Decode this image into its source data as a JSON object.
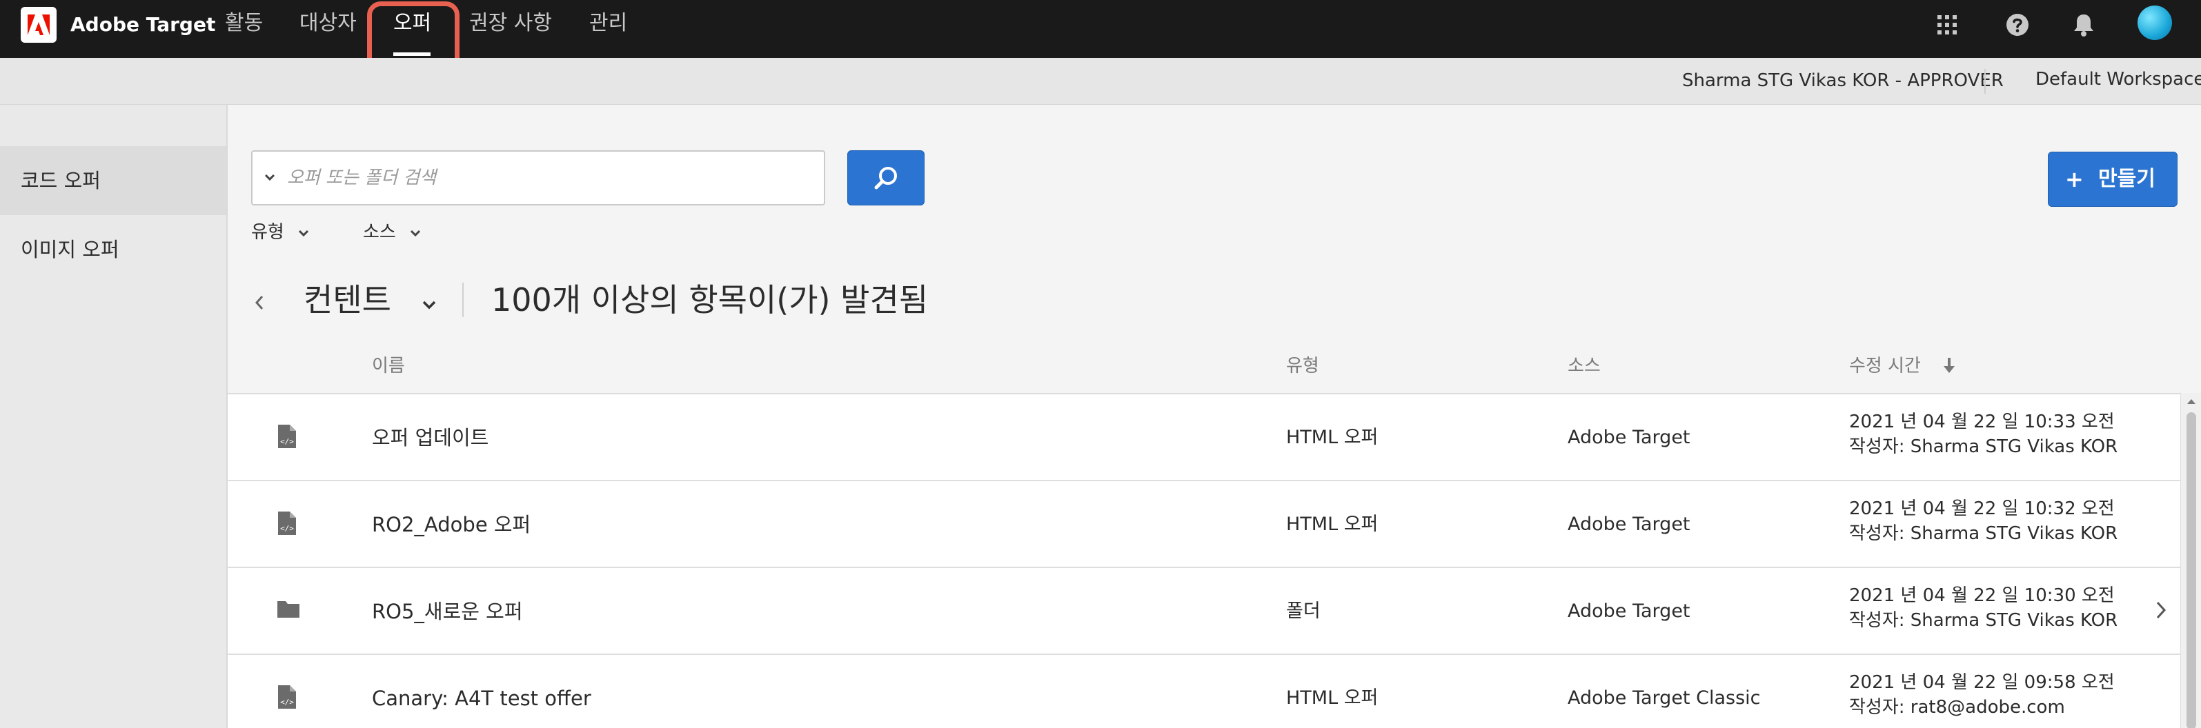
{
  "header": {
    "app_name": "Adobe Target",
    "nav": [
      "활동",
      "대상자",
      "오퍼",
      "권장 사항",
      "관리"
    ],
    "active_nav": "오퍼"
  },
  "subheader": {
    "user": "Sharma STG Vikas KOR - APPROVER",
    "workspace": "Default Workspace"
  },
  "sidebar": {
    "items": [
      "코드 오퍼",
      "이미지 오퍼"
    ],
    "active": "코드 오퍼"
  },
  "search": {
    "placeholder": "오퍼 또는 폴더 검색",
    "value": ""
  },
  "create_button": {
    "icon": "+",
    "label": "만들기"
  },
  "filters": [
    "유형",
    "소스"
  ],
  "breadcrumb": {
    "title": "컨텐트",
    "count_text": "100개 이상의 항목이(가) 발견됨"
  },
  "table": {
    "columns": [
      "이름",
      "유형",
      "소스",
      "수정 시간"
    ],
    "sort_column": "수정 시간",
    "rows": [
      {
        "icon": "code-file-icon",
        "name": "오퍼 업데이트",
        "type": "HTML 오퍼",
        "source": "Adobe Target",
        "modified": "2021 년 04 월 22 일  10:33 오전",
        "author": "작성자: Sharma STG Vikas KOR"
      },
      {
        "icon": "code-file-icon",
        "name": "RO2_Adobe 오퍼",
        "type": "HTML 오퍼",
        "source": "Adobe Target",
        "modified": "2021 년 04 월 22 일  10:32 오전",
        "author": "작성자: Sharma STG Vikas KOR"
      },
      {
        "icon": "folder-icon",
        "name": "RO5_새로운 오퍼",
        "type": "폴더",
        "source": "Adobe Target",
        "modified": "2021 년 04 월 22 일  10:30 오전",
        "author": "작성자: Sharma STG Vikas KOR"
      },
      {
        "icon": "code-file-icon",
        "name": "Canary: A4T test offer",
        "type": "HTML 오퍼",
        "source": "Adobe Target Classic",
        "modified": "2021 년 04 월 22 일  09:58 오전",
        "author": "작성자: rat8@adobe.com"
      }
    ]
  },
  "colors": {
    "topbar": "#1a1a1a",
    "accent_blue": "#2b74d1",
    "highlight": "#e8604f",
    "adobe_red": "#eb1000"
  }
}
